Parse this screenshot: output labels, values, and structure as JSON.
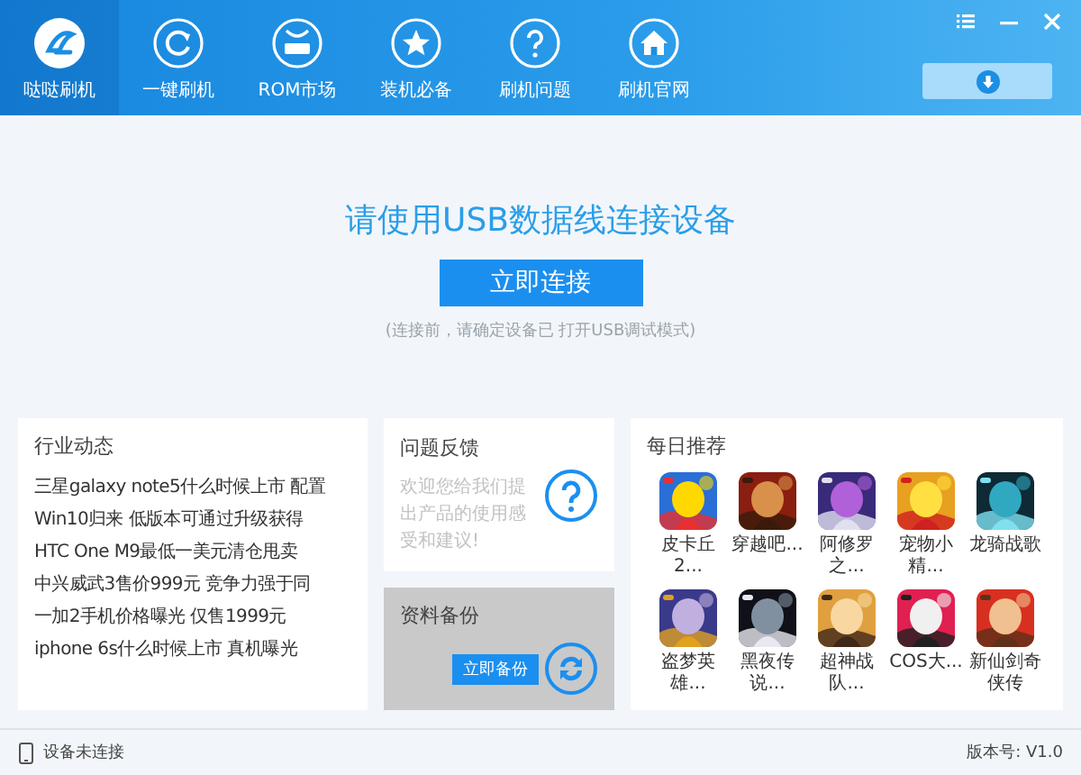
{
  "nav": {
    "items": [
      {
        "label": "哒哒刷机",
        "selected": true
      },
      {
        "label": "一键刷机",
        "selected": false
      },
      {
        "label": "ROM市场",
        "selected": false
      },
      {
        "label": "装机必备",
        "selected": false
      },
      {
        "label": "刷机问题",
        "selected": false
      },
      {
        "label": "刷机官网",
        "selected": false
      }
    ]
  },
  "connect": {
    "title": "请使用USB数据线连接设备",
    "button": "立即连接",
    "hint": "(连接前，请确定设备已 打开USB调试模式)"
  },
  "news": {
    "title": "行业动态",
    "items": [
      "三星galaxy note5什么时候上市 配置",
      "Win10归来 低版本可通过升级获得",
      "HTC One M9最低一美元清仓甩卖",
      "中兴威武3售价999元 竞争力强于同",
      "一加2手机价格曝光 仅售1999元",
      "iphone 6s什么时候上市 真机曝光"
    ]
  },
  "feedback": {
    "title": "问题反馈",
    "text": "欢迎您给我们提出产品的使用感受和建议!"
  },
  "backup": {
    "title": "资料备份",
    "button": "立即备份"
  },
  "daily": {
    "title": "每日推荐",
    "apps": [
      {
        "label": "皮卡丘2..."
      },
      {
        "label": "穿越吧..."
      },
      {
        "label": "阿修罗之..."
      },
      {
        "label": "宠物小精..."
      },
      {
        "label": "龙骑战歌"
      },
      {
        "label": "盗梦英雄..."
      },
      {
        "label": "黑夜传说..."
      },
      {
        "label": "超神战队..."
      },
      {
        "label": "COS大..."
      },
      {
        "label": "新仙剑奇侠传"
      }
    ]
  },
  "status_bar": {
    "device": "设备未连接",
    "version": "版本号: V1.0"
  }
}
